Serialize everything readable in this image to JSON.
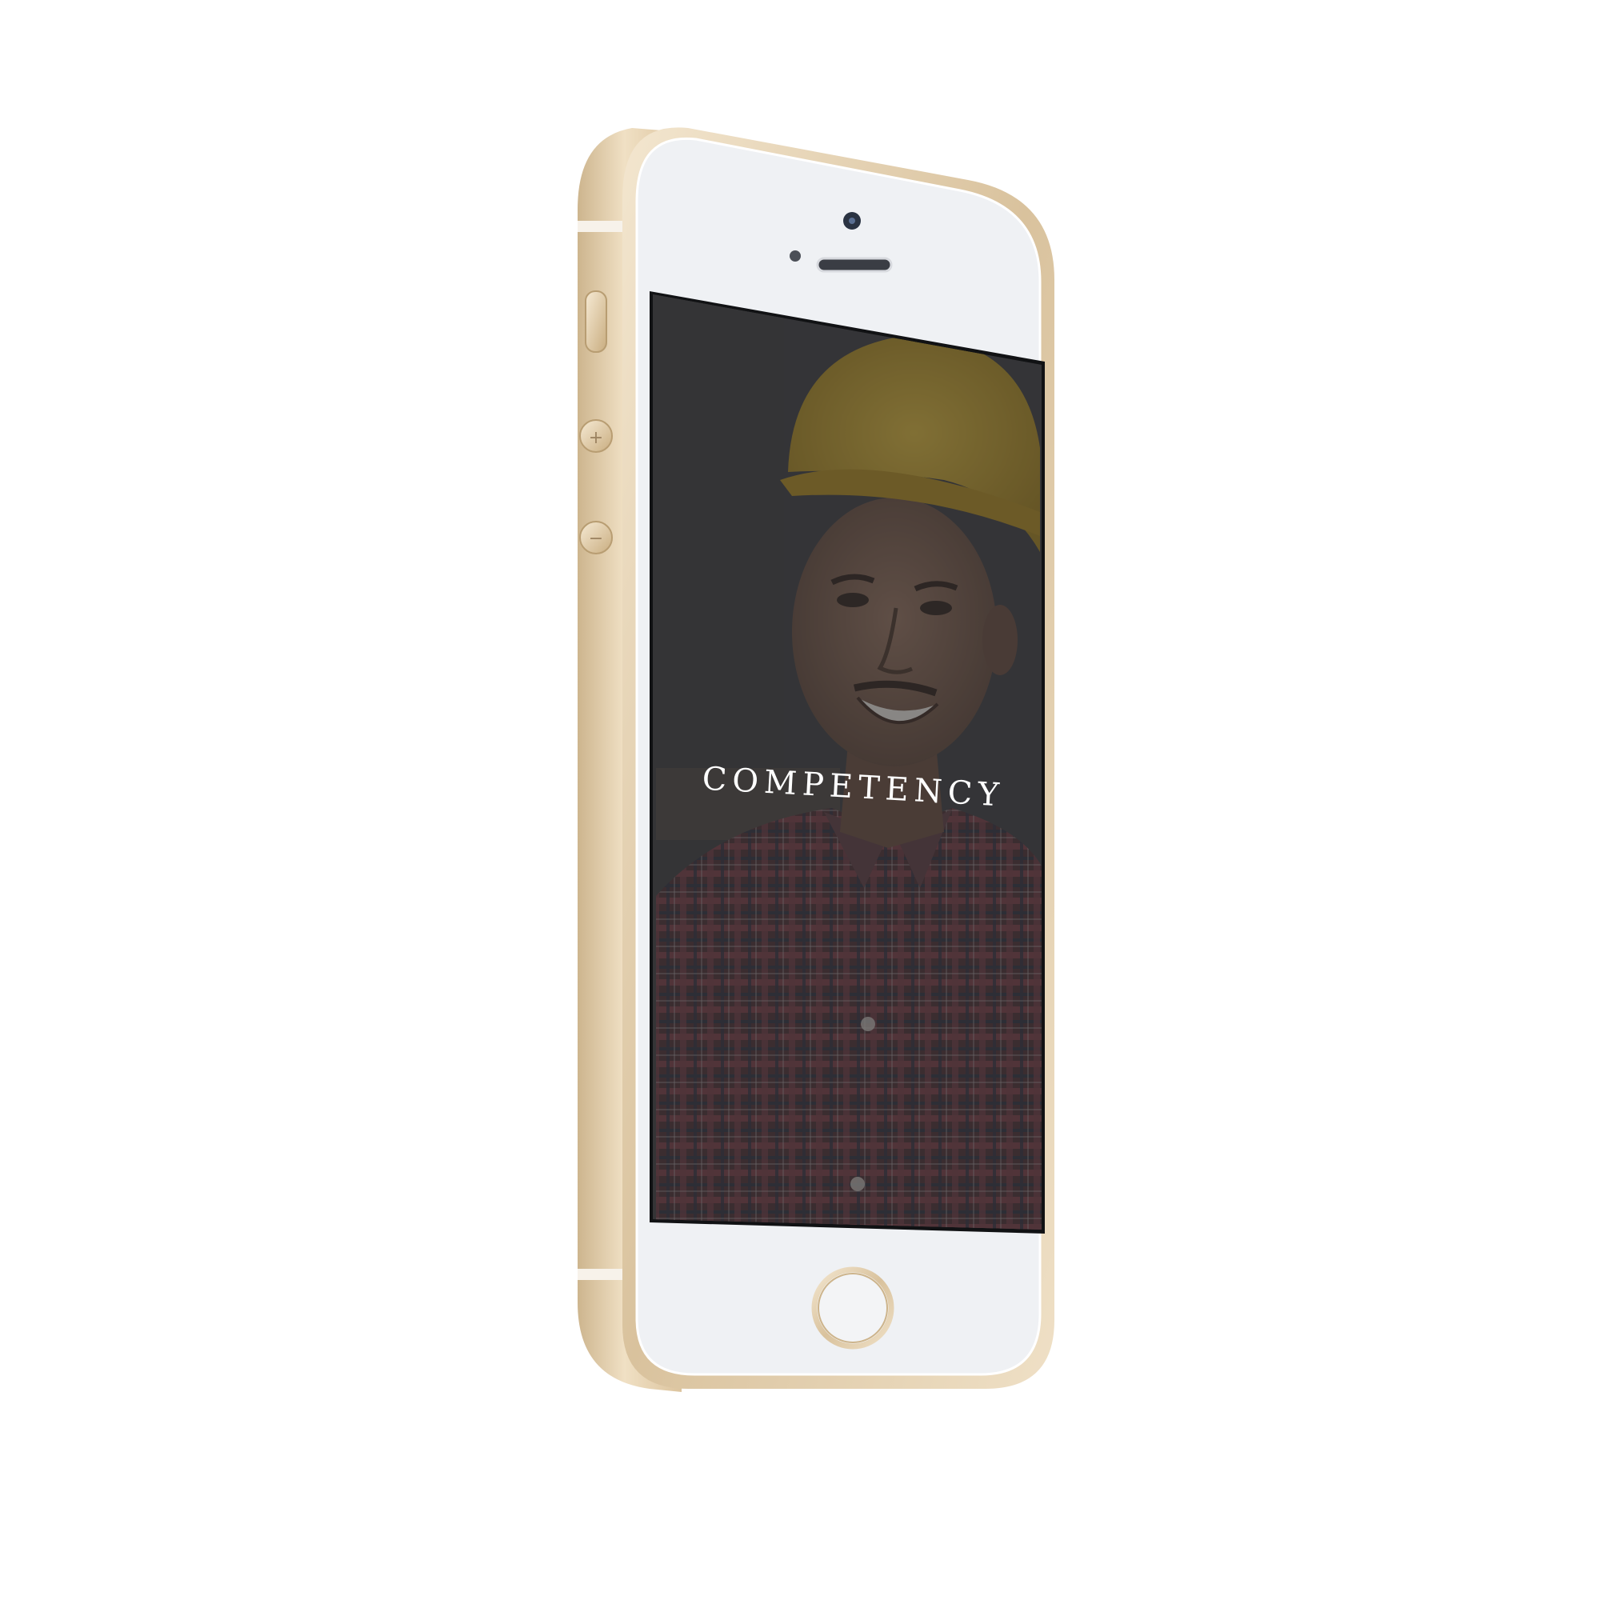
{
  "device": {
    "frame_color": "#e7d4b4",
    "face_color": "#eff1f4"
  },
  "splash_screen": {
    "app_title": "COMPETENCY",
    "background_photo": "smiling-construction-worker-hard-hat",
    "overlay_color": "#2f2f31",
    "accent_helmet_color": "#d4ac2a"
  }
}
